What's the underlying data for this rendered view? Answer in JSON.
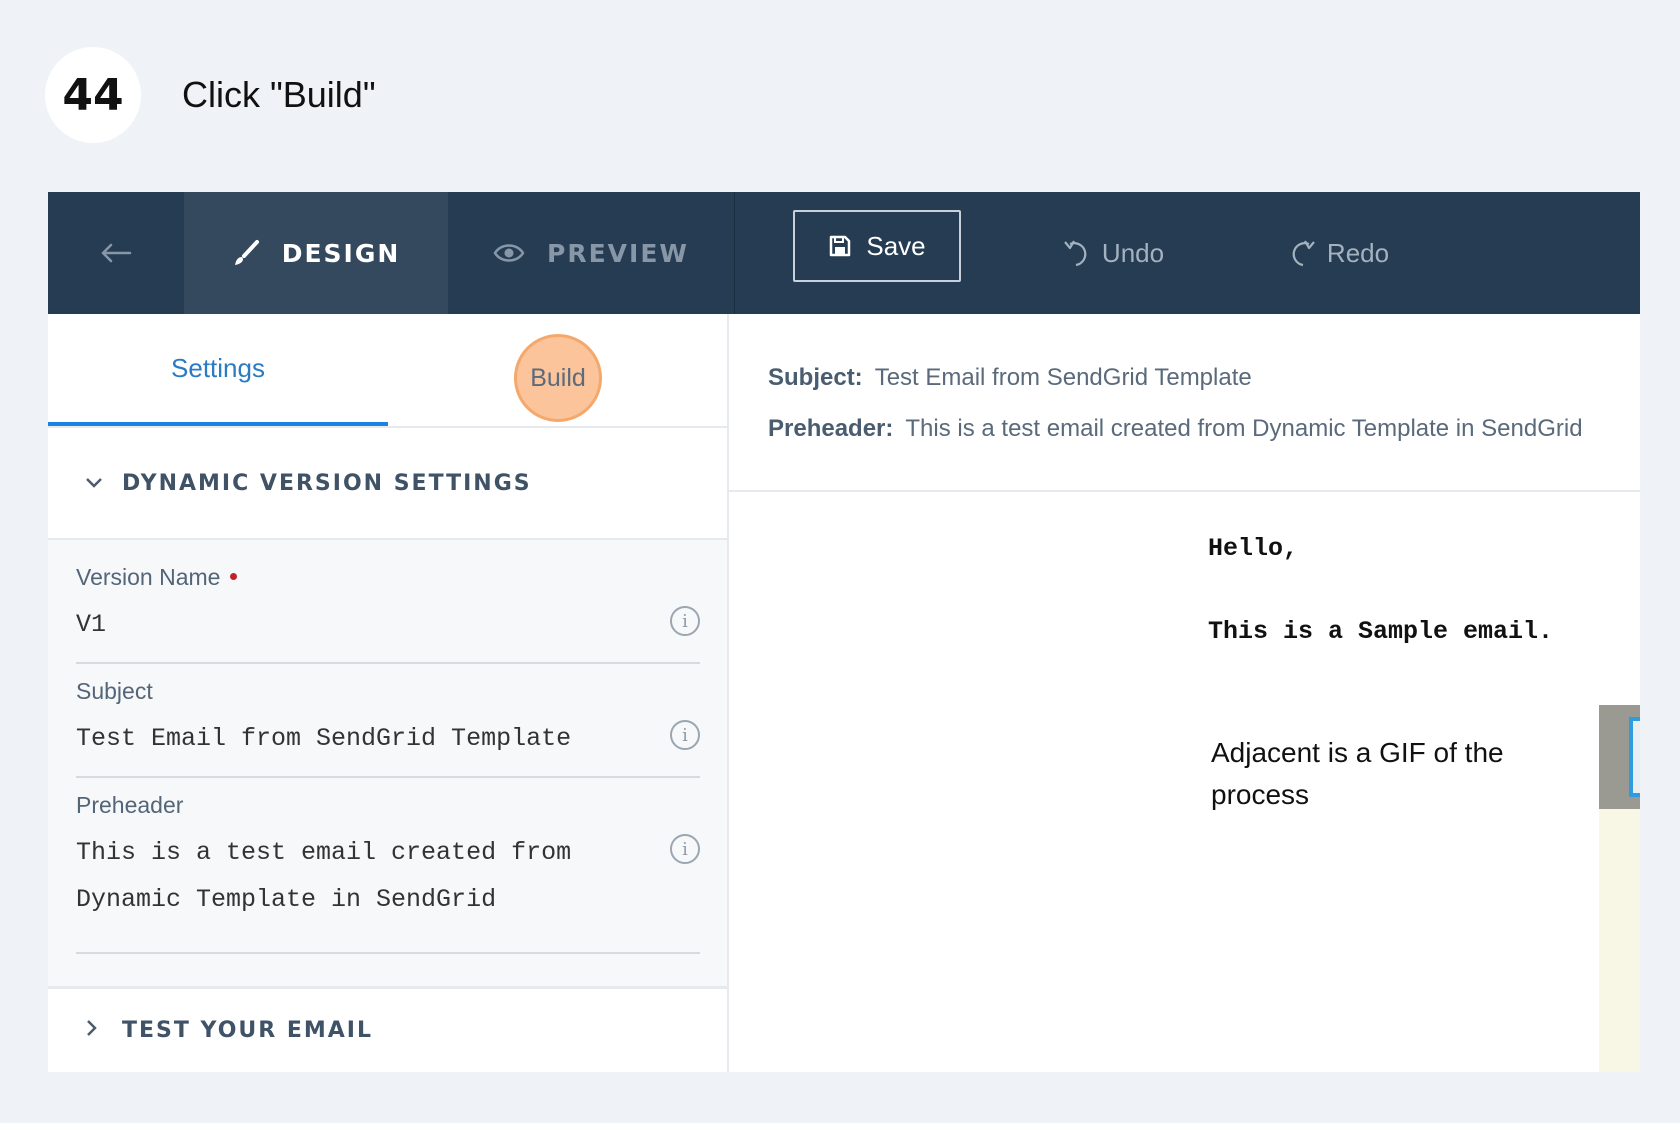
{
  "step": {
    "number": "44",
    "instruction": "Click \"Build\""
  },
  "toolbar": {
    "design_label": "DESIGN",
    "preview_label": "PREVIEW",
    "save_label": "Save",
    "undo_label": "Undo",
    "redo_label": "Redo",
    "icons": [
      "back-arrow-icon",
      "paintbrush-icon",
      "eye-icon",
      "save-icon",
      "undo-icon",
      "redo-icon"
    ]
  },
  "tabs": {
    "settings": "Settings",
    "build": "Build"
  },
  "dynamic_version": {
    "title": "DYNAMIC VERSION SETTINGS",
    "fields": {
      "version_name": {
        "label": "Version Name",
        "required": true,
        "value": "V1"
      },
      "subject": {
        "label": "Subject",
        "value": "Test Email from SendGrid Template"
      },
      "preheader": {
        "label": "Preheader",
        "value": "This is a test email created from Dynamic Template in SendGrid"
      }
    }
  },
  "test_section": {
    "title": "TEST YOUR EMAIL"
  },
  "preview": {
    "subject_label": "Subject:",
    "subject_value": "Test Email from SendGrid Template",
    "preheader_label": "Preheader:",
    "preheader_value": "This is a test email created from Dynamic Template in SendGrid",
    "greeting": "Hello,",
    "line": "This is a Sample email.",
    "paragraph": "Adjacent is a GIF of the process"
  },
  "colors": {
    "toolbar_bg": "#253c52",
    "design_tab_bg": "#34495e",
    "tab_active": "#1a82e2",
    "highlight": "#fbc49a",
    "required": "#c4202b"
  }
}
